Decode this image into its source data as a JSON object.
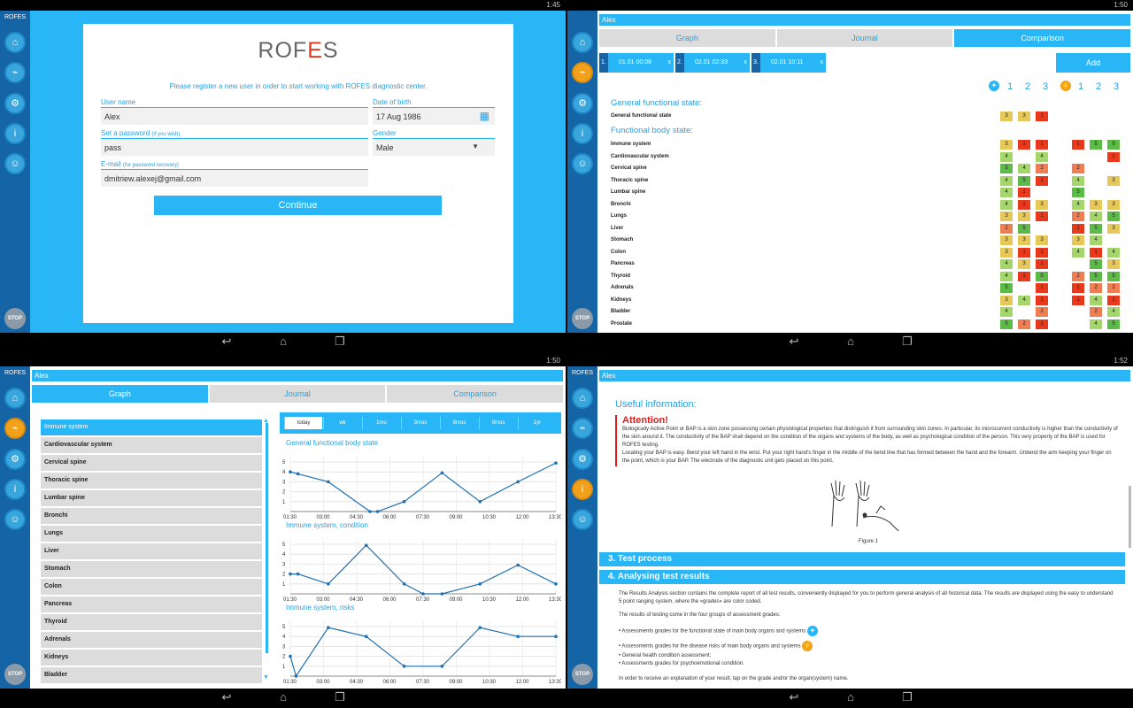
{
  "status": {
    "p1_time": "1:45",
    "p2_time": "1:50",
    "p3_time": "1:50",
    "p4_time": "1:52"
  },
  "brand": "ROFES",
  "sidebar": {
    "icons": [
      "home-icon",
      "chart-icon",
      "gear-icon",
      "info-icon",
      "users-icon"
    ],
    "stop": "STOP"
  },
  "user": "Alex",
  "tabs": [
    "Graph",
    "Journal",
    "Comparison"
  ],
  "register": {
    "logo": "ROFES",
    "intro": "Please register a new user in order to start working with ROFES diagnostic center.",
    "username_label": "User name",
    "username_value": "Alex",
    "dob_label": "Date of birth",
    "dob_value": "17 Aug 1986",
    "password_label": "Set a password",
    "password_hint": "(if you wish)",
    "password_value": "pass",
    "gender_label": "Gender",
    "gender_value": "Male",
    "email_label": "E-mail",
    "email_hint": "(for password recovery)",
    "email_value": "dmitriew.alexej@gmail.com",
    "continue": "Continue"
  },
  "comparison": {
    "dates": [
      {
        "n": "1.",
        "d": "01.01 00:08",
        "x": "x"
      },
      {
        "n": "2.",
        "d": "02.01 02:33",
        "x": "x"
      },
      {
        "n": "3.",
        "d": "02.01 10:11",
        "x": "x"
      }
    ],
    "add": "Add",
    "group_headers": [
      "1",
      "2",
      "3",
      "1",
      "2",
      "3"
    ],
    "general_title": "General functional state:",
    "general_row": {
      "name": "General functional state",
      "a": [
        "3",
        "3",
        "1"
      ],
      "b": [
        "",
        "",
        ""
      ]
    },
    "body_title": "Functional body state:",
    "rows": [
      {
        "name": "Immune system",
        "a": [
          "3",
          "1",
          "1"
        ],
        "b": [
          "1",
          "5",
          "5"
        ]
      },
      {
        "name": "Cardiovascular system",
        "a": [
          "4",
          "",
          "4"
        ],
        "b": [
          "",
          "",
          "1"
        ]
      },
      {
        "name": "Cervical spine",
        "a": [
          "5",
          "4",
          "2"
        ],
        "b": [
          "2",
          "",
          ""
        ]
      },
      {
        "name": "Thoracic spine",
        "a": [
          "4",
          "5",
          "1"
        ],
        "b": [
          "4",
          "",
          "3"
        ]
      },
      {
        "name": "Lumbar spine",
        "a": [
          "4",
          "1",
          ""
        ],
        "b": [
          "5",
          "",
          ""
        ]
      },
      {
        "name": "Bronchi",
        "a": [
          "4",
          "1",
          "3"
        ],
        "b": [
          "4",
          "3",
          "3"
        ]
      },
      {
        "name": "Lungs",
        "a": [
          "3",
          "3",
          "1"
        ],
        "b": [
          "2",
          "4",
          "5"
        ]
      },
      {
        "name": "Liver",
        "a": [
          "2",
          "5",
          ""
        ],
        "b": [
          "1",
          "5",
          "3"
        ]
      },
      {
        "name": "Stomach",
        "a": [
          "3",
          "3",
          "3"
        ],
        "b": [
          "3",
          "4",
          ""
        ]
      },
      {
        "name": "Colon",
        "a": [
          "3",
          "1",
          "1"
        ],
        "b": [
          "4",
          "1",
          "4"
        ]
      },
      {
        "name": "Pancreas",
        "a": [
          "4",
          "3",
          "1"
        ],
        "b": [
          "",
          "5",
          "3"
        ]
      },
      {
        "name": "Thyroid",
        "a": [
          "4",
          "1",
          "5"
        ],
        "b": [
          "2",
          "5",
          "5"
        ]
      },
      {
        "name": "Adrenals",
        "a": [
          "5",
          "",
          "1"
        ],
        "b": [
          "1",
          "2",
          "2"
        ]
      },
      {
        "name": "Kidneys",
        "a": [
          "3",
          "4",
          "1"
        ],
        "b": [
          "1",
          "4",
          "1"
        ]
      },
      {
        "name": "Bladder",
        "a": [
          "4",
          "",
          "2"
        ],
        "b": [
          "",
          "2",
          "4"
        ]
      },
      {
        "name": "Prostate",
        "a": [
          "5",
          "2",
          "1"
        ],
        "b": [
          "",
          "4",
          "5"
        ]
      }
    ],
    "colors": {
      "1": "#e8391c",
      "2": "#ef7f52",
      "3": "#e5c75a",
      "4": "#a5d66b",
      "5": "#5cba47"
    }
  },
  "graph": {
    "list": [
      "Immune system",
      "Cardiovascular system",
      "Cervical spine",
      "Thoracic spine",
      "Lumbar spine",
      "Bronchi",
      "Lungs",
      "Liver",
      "Stomach",
      "Colon",
      "Pancreas",
      "Thyroid",
      "Adrenals",
      "Kidneys",
      "Bladder"
    ],
    "periods": [
      "today",
      "wk",
      "1mo",
      "3mos",
      "6mos",
      "9mos",
      "1yr"
    ]
  },
  "chart_data": [
    {
      "type": "line",
      "title": "General functional body state",
      "x": [
        "01:30",
        "03:00",
        "04:30",
        "06:00",
        "07:30",
        "09:00",
        "10:30",
        "12:00",
        "13:30"
      ],
      "xticks": [
        "01:30",
        "03:00",
        "04:30",
        "06:00",
        "07:30",
        "09:00",
        "10:30",
        "12:00",
        "13:30"
      ],
      "ylim": [
        0,
        5
      ],
      "yticks": [
        "1",
        "2",
        "3",
        "4",
        "5"
      ],
      "points": [
        [
          0,
          4
        ],
        [
          0.2,
          3.8
        ],
        [
          1,
          3
        ],
        [
          2.1,
          0
        ],
        [
          2.3,
          0
        ],
        [
          3,
          1
        ],
        [
          4,
          3.9
        ],
        [
          5,
          1
        ],
        [
          6,
          3
        ],
        [
          7,
          4.9
        ]
      ]
    },
    {
      "type": "line",
      "title": "Immune system, condition",
      "xticks": [
        "01:30",
        "03:00",
        "04:30",
        "06:00",
        "07:30",
        "09:00",
        "10:30",
        "12:00",
        "13:30"
      ],
      "ylim": [
        0,
        5
      ],
      "yticks": [
        "1",
        "2",
        "3",
        "4",
        "5"
      ],
      "points": [
        [
          0,
          2
        ],
        [
          0.2,
          2
        ],
        [
          1,
          1
        ],
        [
          2,
          4.9
        ],
        [
          3,
          1
        ],
        [
          3.5,
          0
        ],
        [
          4,
          0
        ],
        [
          5,
          1
        ],
        [
          6,
          2.9
        ],
        [
          7,
          1
        ]
      ]
    },
    {
      "type": "line",
      "title": "Immune system, risks",
      "xticks": [
        "01:30",
        "03:00",
        "04:30",
        "06:00",
        "07:30",
        "09:00",
        "10:30",
        "12:00",
        "13:30"
      ],
      "ylim": [
        0,
        5
      ],
      "yticks": [
        "1",
        "2",
        "3",
        "4",
        "5"
      ],
      "points": [
        [
          0,
          2
        ],
        [
          0.15,
          0
        ],
        [
          1,
          4.9
        ],
        [
          2,
          4
        ],
        [
          3,
          1
        ],
        [
          4,
          1
        ],
        [
          5,
          4.9
        ],
        [
          6,
          4
        ],
        [
          7,
          4
        ]
      ]
    }
  ],
  "info": {
    "title": "Useful information:",
    "attention": "Attention!",
    "att_text": "Biologically Active Point or BAP is a skin zone possessing certain physiological properties that distinguish it from surrounding skin zones. In particular, its microcurrent conductivity is higher than the conductivity of the skin around it. The conductivity of the BAP shall depend on the condition of the organs and systems of the body, as well as psychological condition of the person. This very property of the BAP is used for ROFES testing.",
    "att_text2": "Locating your BAP is easy. Bend your left hand in the wrist. Put your right hand's finger in the middle of the bend line that has formed between the hand and the forearm. Unbend the arm keeping your finger on the point, which is your BAP. The electrode of the diagnostic unit gets placed on this point.",
    "figure": "Figure 1",
    "sec3": "3. Test process",
    "sec4": "4. Analysing test results",
    "p1": "The Results Analysis section contains the complete report of all test results, conveniently displayed for you to perform general analysis of all historical data. The results are displayed using the easy to understand 5 point ranging system, where the «grades» are color coded.",
    "p2": "The results of testing come in the four groups of assessment grades:",
    "b1": "• Assessments grades for the functional state of main body organs and systems",
    "b2": "• Assessments grades for the disease risks of main body organs and systems",
    "b3": "• General health condition assessment;",
    "b4": "• Assessments grades for psychoemotional condition.",
    "p3": "In order to receive an explanation of your result, tap on the grade and/or the organ(system) name."
  }
}
